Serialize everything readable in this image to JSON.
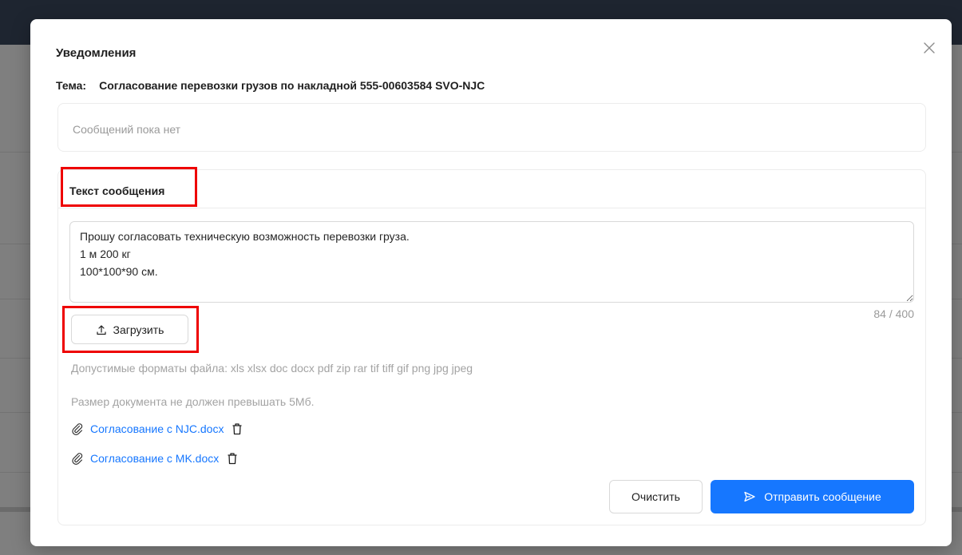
{
  "modal": {
    "title": "Уведомления",
    "subject_label": "Тема:",
    "subject_value": "Согласование перевозки грузов по накладной 555-00603584 SVO-NJC",
    "messages_empty": "Сообщений пока нет"
  },
  "compose": {
    "title": "Текст сообщения",
    "message_text": "Прошу согласовать техническую возможность перевозки груза.\n1 м 200 кг\n100*100*90 см.",
    "char_count": "84 / 400",
    "upload_label": "Загрузить",
    "allowed_formats": "Допустимые форматы файла: xls xlsx doc docx pdf zip rar tif tiff gif png jpg jpeg",
    "size_limit": "Размер документа не должен превышать 5Мб.",
    "files": [
      {
        "name": "Согласование с NJC.docx"
      },
      {
        "name": "Согласование с MK.docx"
      }
    ],
    "clear_label": "Очистить",
    "send_label": "Отправить сообщение"
  },
  "colors": {
    "primary": "#1677ff",
    "highlight": "#ee0000",
    "link": "#1677ff"
  },
  "icons": {
    "close": "close-icon",
    "upload": "upload-icon",
    "attachment": "paperclip-icon",
    "delete": "trash-icon",
    "send": "send-icon"
  }
}
